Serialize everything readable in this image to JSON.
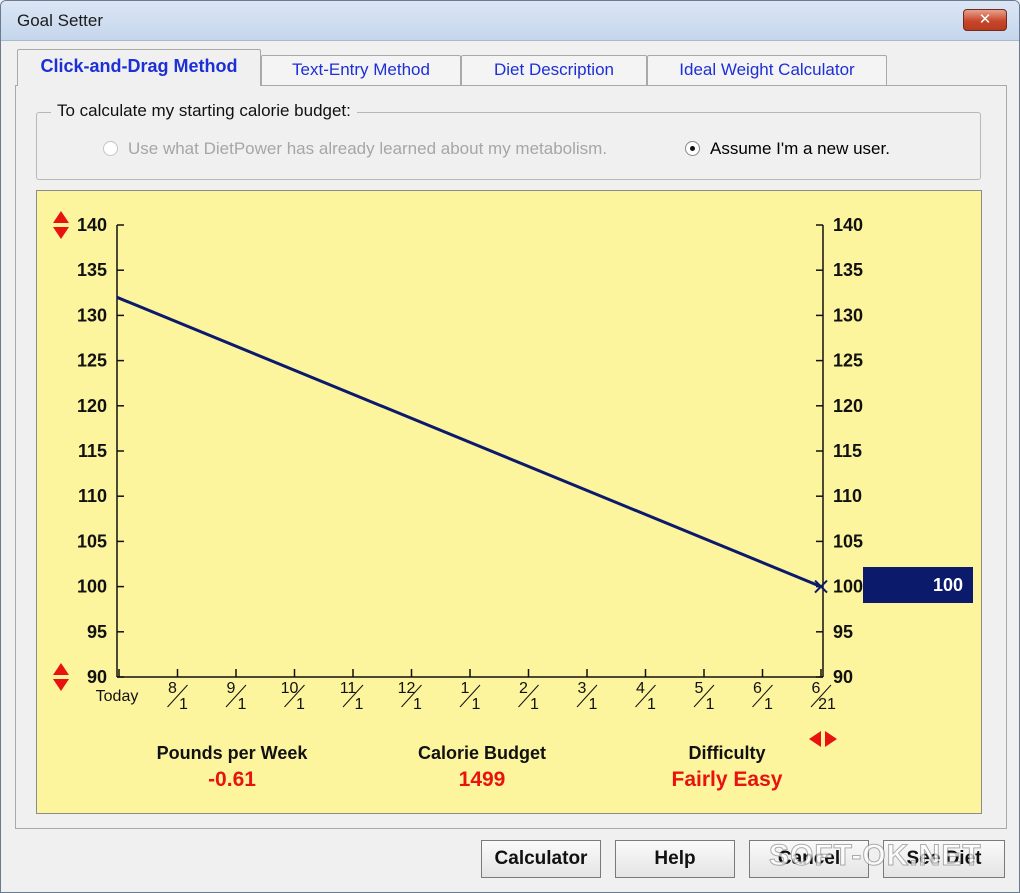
{
  "window": {
    "title": "Goal Setter",
    "close_label": "✕"
  },
  "tabs": [
    {
      "label": "Click-and-Drag Method",
      "active": true
    },
    {
      "label": "Text-Entry Method",
      "active": false
    },
    {
      "label": "Diet Description",
      "active": false
    },
    {
      "label": "Ideal Weight Calculator",
      "active": false
    }
  ],
  "group": {
    "legend": "To calculate my starting calorie budget:",
    "option_learned": "Use what DietPower has already learned about my metabolism.",
    "option_new": "Assume I'm a new user.",
    "selected": "new"
  },
  "chart_data": {
    "type": "line",
    "ylim": [
      90,
      140
    ],
    "y_ticks": [
      "140",
      "135",
      "130",
      "125",
      "120",
      "115",
      "110",
      "105",
      "100",
      "95",
      "90"
    ],
    "x_ticks": [
      {
        "top": "Today",
        "bottom": ""
      },
      {
        "top": "8",
        "bottom": "1"
      },
      {
        "top": "9",
        "bottom": "1"
      },
      {
        "top": "10",
        "bottom": "1"
      },
      {
        "top": "11",
        "bottom": "1"
      },
      {
        "top": "12",
        "bottom": "1"
      },
      {
        "top": "1",
        "bottom": "1"
      },
      {
        "top": "2",
        "bottom": "1"
      },
      {
        "top": "3",
        "bottom": "1"
      },
      {
        "top": "4",
        "bottom": "1"
      },
      {
        "top": "5",
        "bottom": "1"
      },
      {
        "top": "6",
        "bottom": "1"
      },
      {
        "top": "6",
        "bottom": "21"
      }
    ],
    "series": [
      {
        "start": 132,
        "end": 100
      }
    ],
    "goal_weight": "100",
    "line_color": "#0b1a6b",
    "handle_color": "#e8120e"
  },
  "stats": {
    "pounds_label": "Pounds per Week",
    "pounds_value": "-0.61",
    "calorie_label": "Calorie Budget",
    "calorie_value": "1499",
    "difficulty_label": "Difficulty",
    "difficulty_value": "Fairly Easy"
  },
  "buttons": {
    "calculator": "Calculator",
    "help": "Help",
    "cancel": "Cancel",
    "see_diet": "See Diet"
  },
  "watermark": "SOFT-OK.NET"
}
